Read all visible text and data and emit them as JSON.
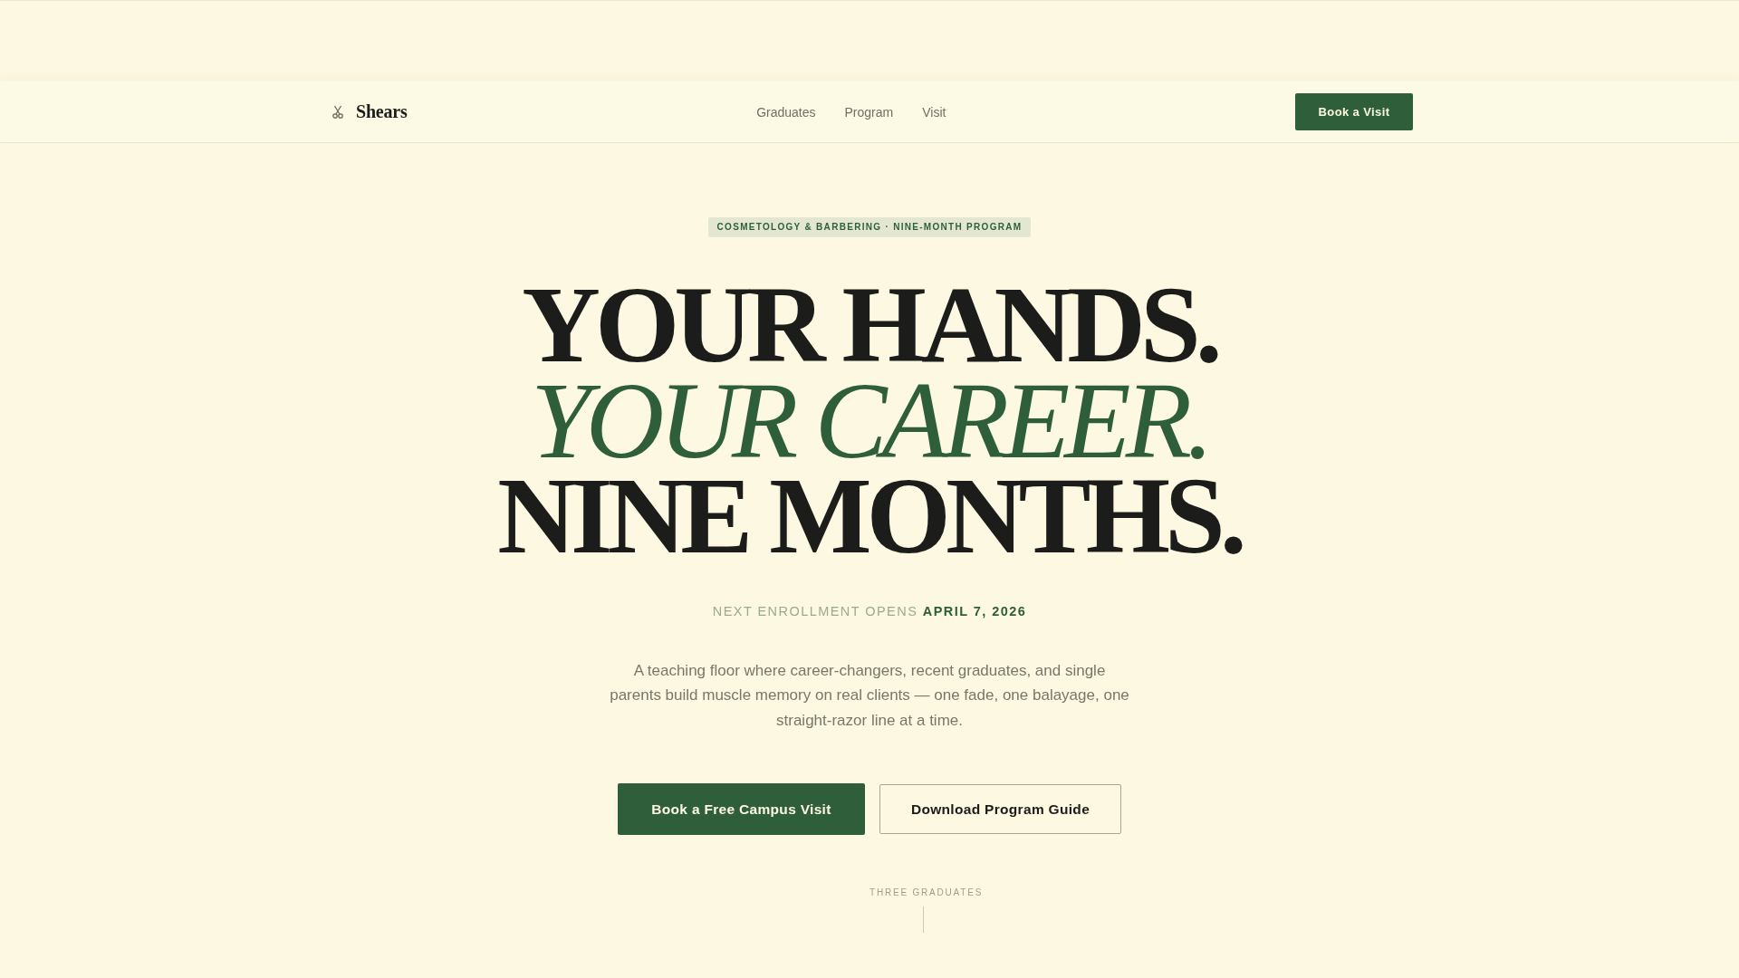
{
  "nav": {
    "brand": "Shears",
    "links": [
      "Graduates",
      "Program",
      "Visit"
    ],
    "cta": "Book a Visit"
  },
  "hero": {
    "eyebrow": "COSMETOLOGY & BARBERING · NINE-MONTH PROGRAM",
    "headline": [
      {
        "text": "YOUR HANDS.",
        "kind": "plain"
      },
      {
        "text": "YOUR CAREER.",
        "kind": "accent"
      },
      {
        "text": "NINE MONTHS.",
        "kind": "plain"
      }
    ],
    "enrollment": "NEXT ENROLLMENT OPENS **APRIL 7, 2026**",
    "description": "A teaching floor where career-changers, recent graduates, and single parents build muscle memory on real clients — one fade, one balayage, one straight-razor line at a time.",
    "buttons": [
      {
        "label": "Book a Free Campus Visit",
        "kind": "primary"
      },
      {
        "label": "Download Program Guide",
        "kind": "secondary"
      }
    ]
  },
  "scroll_cue": {
    "label": "THREE GRADUATES"
  }
}
